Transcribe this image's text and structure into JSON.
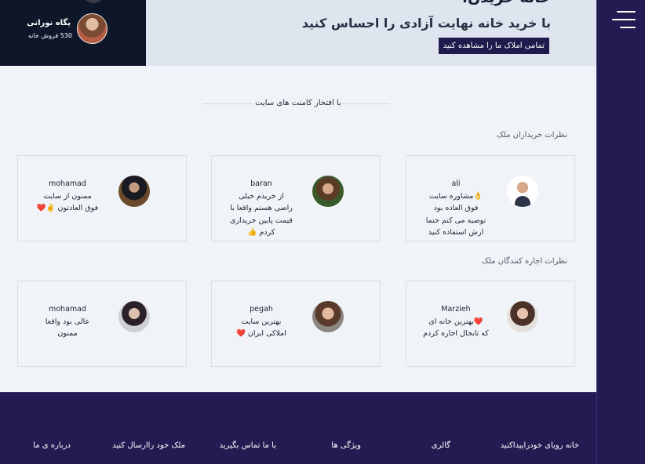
{
  "hero": {
    "heading_partial": "خانه خریدن.",
    "subtitle": "با خرید خانه نهایت آزادی را احساس کنید",
    "cta": "تمامی املاک ما را مشاهده کنید"
  },
  "agent": {
    "name": "پگاه نورانی",
    "sales": "530 فروش خانه"
  },
  "comments": {
    "section_title": "با افتخار کامنت های سایت",
    "buyers_title": "نظرات خریداران ملک",
    "renters_title": "نظرات اجاره کنندگان ملک",
    "buyers": [
      {
        "name": "ali",
        "lines": [
          "👌مشاوره سایت",
          "فوق العاده بود",
          "توصیه می کنم حتما",
          "ارش استفاده کنید"
        ],
        "avatar": "man-suit-avatar"
      },
      {
        "name": "baran",
        "lines": [
          "از خریدم خیلی",
          "راضی هستم واقعا با",
          "قیمت پایین خریداری",
          "کردم 👍"
        ],
        "avatar": "woman-curly-avatar"
      },
      {
        "name": "mohamad",
        "lines": [
          "ممنون از سایت",
          "فوق العادتون ✌️❤️"
        ],
        "avatar": "man-dark-avatar"
      }
    ],
    "renters": [
      {
        "name": "Marzieh",
        "lines": [
          "❤️بهترین خانه ای",
          "که تابحال اجاره کردم"
        ],
        "avatar": "woman-smiling-avatar"
      },
      {
        "name": "pegah",
        "lines": [
          "بهترین سایت",
          "املاکی ایران ❤️"
        ],
        "avatar": "woman-brunette-avatar"
      },
      {
        "name": "mohamad",
        "lines": [
          "عالی بود واقعا",
          "ممنون"
        ],
        "avatar": "woman-dark-hair-avatar"
      }
    ]
  },
  "footer": {
    "links": [
      "خانه رویای خودراپیداکنید",
      "گالری",
      "ویژگی ها",
      "با ما تماس بگیرید",
      "ملک خود راارسال کنید",
      "درباره ی ما"
    ]
  },
  "colors": {
    "navy": "#221c52",
    "hero_dark": "#0e1629",
    "hero_light": "#dfe5ef",
    "content_bg": "#f0f3f8"
  }
}
